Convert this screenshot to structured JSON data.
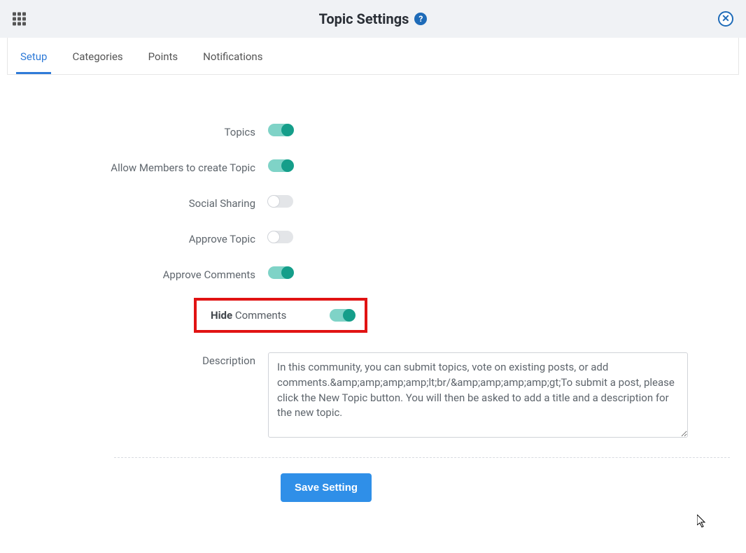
{
  "header": {
    "title": "Topic Settings"
  },
  "tabs": {
    "setup": "Setup",
    "categories": "Categories",
    "points": "Points",
    "notifications": "Notifications",
    "active": "setup"
  },
  "settings": {
    "topics": {
      "label": "Topics",
      "value": true
    },
    "allow_members": {
      "label": "Allow Members to create Topic",
      "value": true
    },
    "social_sharing": {
      "label": "Social Sharing",
      "value": false
    },
    "approve_topic": {
      "label": "Approve Topic",
      "value": false
    },
    "approve_comments": {
      "label": "Approve Comments",
      "value": true
    },
    "hide_comments": {
      "label_strong": "Hide",
      "label_rest": " Comments",
      "value": true,
      "highlighted": true
    },
    "description": {
      "label": "Description",
      "value": "In this community, you can submit topics, vote on existing posts, or add comments.&amp;amp;amp;amp;lt;br/&amp;amp;amp;amp;gt;To submit a post, please click the New Topic button. You will then be asked to add a title and a description for the new topic."
    }
  },
  "buttons": {
    "save": "Save Setting"
  }
}
